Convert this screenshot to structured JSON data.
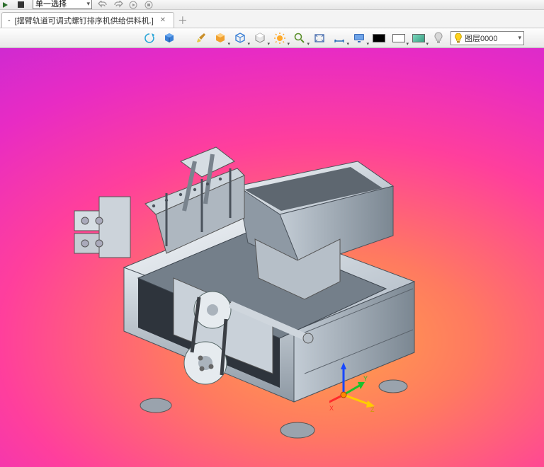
{
  "cmdbar": {
    "selection_mode": "单一选择"
  },
  "tabs": {
    "active": {
      "prefix": "-",
      "title": "[摆臂轨道可调式螺钉排序机供给供料机.]"
    }
  },
  "layer": {
    "label": "图层0000"
  },
  "icons": {
    "brush": "brush-icon",
    "cube_blue": "cube-icon",
    "cube_cyan": "cube-icon",
    "cube_white": "cube-icon",
    "sun": "sun-icon",
    "magnify": "magnify-icon",
    "rect": "rect-icon",
    "dim": "dimension-icon",
    "monitor": "monitor-icon",
    "swatch_black": "#000000",
    "swatch_white": "#ffffff",
    "swatch_teal": "#5fbfa8",
    "bulb_off": "#cccccc",
    "bulb_on": "#ffd21f"
  }
}
